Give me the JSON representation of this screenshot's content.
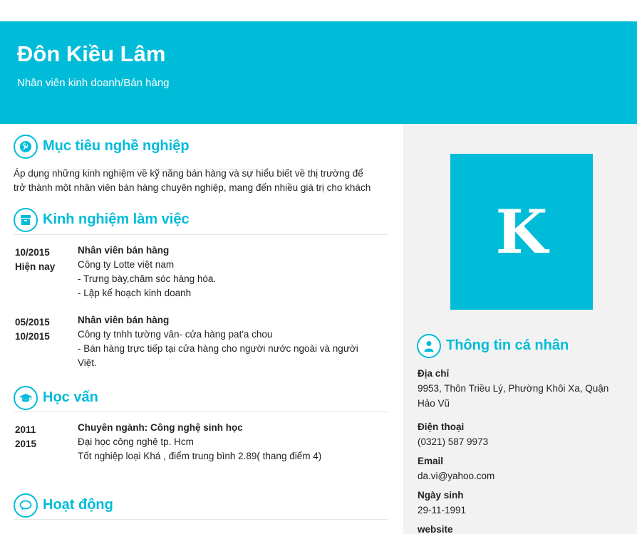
{
  "header": {
    "name": "Đôn Kiều Lâm",
    "role": "Nhân viên kinh doanh/Bán hàng"
  },
  "career_goal": {
    "title": "Mục tiêu nghề nghiệp",
    "icon": "pinterest-icon",
    "text_line1": "Áp dụng những kinh nghiệm về kỹ năng bán hàng và sự hiểu biết về thị trường để",
    "text_line2": "trở thành một nhân viên bán hàng chuyên nghiệp, mang đến nhiều giá trị cho khách"
  },
  "experience": {
    "title": "Kinh nghiệm làm việc",
    "icon": "archive-icon",
    "items": [
      {
        "date_from": "10/2015",
        "date_to": "Hiện nay",
        "position": "Nhân viên bán hàng",
        "company": "Công ty Lotte việt nam",
        "line1": "- Trưng bày,chăm sóc hàng hóa.",
        "line2": "- Lập kế hoạch kinh doanh"
      },
      {
        "date_from": "05/2015",
        "date_to": "10/2015",
        "position": "Nhân viên bán hàng",
        "company": "Công ty tnhh tường vân- cửa hàng pat'a chou",
        "line1": "- Bán hàng trực tiếp tại cửa hàng cho người nước ngoài và người",
        "line2": "Việt."
      }
    ]
  },
  "education": {
    "title": "Học vấn",
    "icon": "graduation-cap-icon",
    "items": [
      {
        "date_from": "2011",
        "date_to": "2015",
        "major": "Chuyên ngành: Công nghệ sinh học",
        "school": "Đại học công nghệ tp. Hcm",
        "result": "Tốt nghiệp loại Khá , điểm trung bình 2.89( thang điểm 4)"
      }
    ]
  },
  "activities": {
    "title": "Hoạt động",
    "icon": "speech-bubble-icon"
  },
  "sidebar": {
    "avatar_letter": "K",
    "personal_info": {
      "title": "Thông tin cá nhân",
      "icon": "user-icon",
      "address_label": "Địa chỉ",
      "address_line1": "9953, Thôn Triều Lý, Phường Khôi Xa, Quận",
      "address_line2": "Hảo Vũ",
      "phone_label": "Điện thoại",
      "phone": "(0321) 587 9973",
      "email_label": "Email",
      "email": "da.vi@yahoo.com",
      "dob_label": "Ngày sinh",
      "dob": "29-11-1991",
      "website_label": "website"
    }
  },
  "colors": {
    "accent": "#00bcd9",
    "sidebar_bg": "#f2f2f2"
  }
}
